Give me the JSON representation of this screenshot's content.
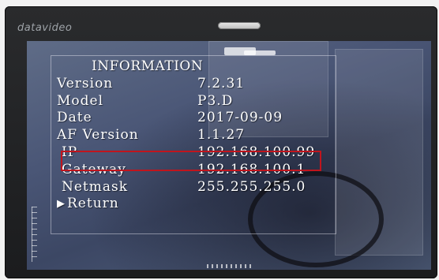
{
  "brand": "datavideo",
  "osd": {
    "title": "INFORMATION",
    "rows": [
      {
        "label": "Version",
        "value": "7.2.31"
      },
      {
        "label": "Model",
        "value": "P3.D"
      },
      {
        "label": "Date",
        "value": "2017-09-09"
      },
      {
        "label": "AF Version",
        "value": "1.1.27"
      },
      {
        "label": "IP",
        "value": "192.168.100.99"
      },
      {
        "label": "Gateway",
        "value": "192.168.100.1"
      },
      {
        "label": "Netmask",
        "value": "255.255.255.0"
      }
    ],
    "return_label": "Return",
    "selected_arrow": "▶"
  },
  "colors": {
    "highlight_box": "#c0151d",
    "osd_text": "#ffffff",
    "bezel": "#1f2022"
  },
  "icons": {
    "selection": "right-triangle-icon"
  }
}
